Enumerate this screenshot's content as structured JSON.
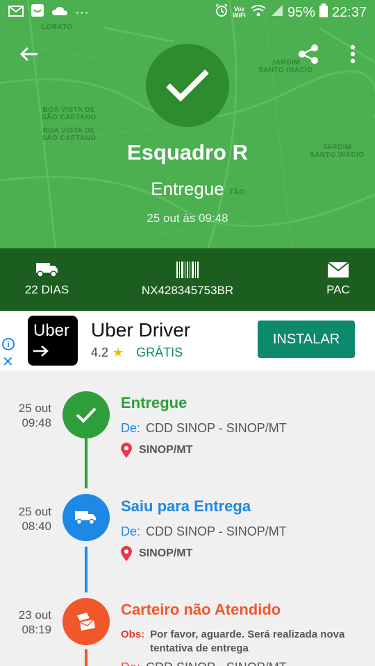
{
  "status_bar": {
    "wifi_label_top": "Voz",
    "wifi_label_bottom": "WiFi",
    "battery": "95%",
    "time": "22:37",
    "dots": "···"
  },
  "map_labels": [
    {
      "text": "LOBATO"
    },
    {
      "text": "JARDIM\nSANTO INÁCIO"
    },
    {
      "text": "BOA VISTA DE\nSÃO CAETANO"
    },
    {
      "text": "BOA VISTA DE\nSÃO CAETANO"
    },
    {
      "text": "JARDIM\nSANTO INÁCIO"
    },
    {
      "text": "TÃO"
    }
  ],
  "package": {
    "name": "Esquadro R",
    "status": "Entregue",
    "datetime": "25 out às 09:48"
  },
  "info": {
    "days": "22 DIAS",
    "code": "NX428345753BR",
    "service": "PAC"
  },
  "ad": {
    "logo_text": "Uber",
    "title": "Uber Driver",
    "rating": "4.2",
    "price": "GRÁTIS",
    "install_label": "INSTALAR"
  },
  "events": [
    {
      "date": "25 out",
      "time": "09:48",
      "title": "Entregue",
      "from_label": "De:",
      "from": "CDD SINOP - SINOP/MT",
      "location": "SINOP/MT",
      "color": "#2e9e3a"
    },
    {
      "date": "25 out",
      "time": "08:40",
      "title": "Saiu para Entrega",
      "from_label": "De:",
      "from": "CDD SINOP - SINOP/MT",
      "location": "SINOP/MT",
      "color": "#1e88e5"
    },
    {
      "date": "23 out",
      "time": "08:19",
      "title": "Carteiro não Atendido",
      "obs_label": "Obs:",
      "obs": "Por favor, aguarde. Será realizada nova tentativa de entrega",
      "from_label": "De:",
      "from": "CDD SINOP - SINOP/MT",
      "color": "#f0582a"
    }
  ]
}
